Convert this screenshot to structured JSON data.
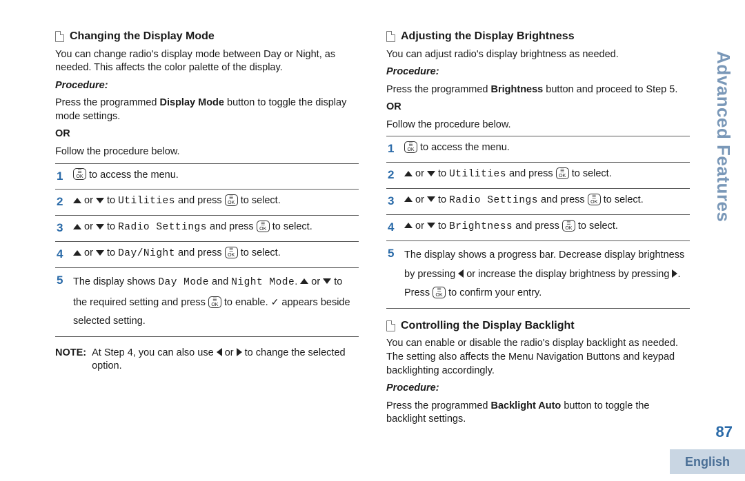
{
  "sideTitle": "Advanced Features",
  "pageNumber": "87",
  "language": "English",
  "left": {
    "heading": "Changing the Display Mode",
    "intro": "You can change radio's display mode between Day or Night, as needed. This affects the color palette of the display.",
    "procLabel": "Procedure:",
    "proc1a": "Press the programmed ",
    "proc1b": "Display Mode",
    "proc1c": " button to toggle the display mode settings.",
    "or": "OR",
    "proc2": "Follow the procedure below.",
    "s1": " to access the menu.",
    "s2or": " or ",
    "s2to": " to ",
    "s2menu": "Utilities",
    "s2press": " and press ",
    "s2sel": " to select.",
    "s3menu": "Radio Settings",
    "s4menu": "Day/Night",
    "s5a": "The display shows ",
    "s5m1": "Day Mode",
    "s5and": " and ",
    "s5m2": "Night Mode",
    "s5dot": ". ",
    "s5to": " to the required setting and press ",
    "s5en": " to enable. ",
    "s5ap": " appears beside selected setting.",
    "noteLabel": "NOTE:",
    "noteA": "At Step 4, you can also use ",
    "noteOr": " or ",
    "noteB": " to change the selected option."
  },
  "rightA": {
    "heading": "Adjusting the Display Brightness",
    "intro": "You can adjust radio's display brightness as needed.",
    "procLabel": "Procedure:",
    "proc1a": "Press the programmed ",
    "proc1b": "Brightness",
    "proc1c": " button and proceed to Step 5.",
    "or": "OR",
    "proc2": "Follow the procedure below.",
    "s1": " to access the menu.",
    "s2menu": "Utilities",
    "s3menu": "Radio Settings",
    "s4menu": "Brightness",
    "s5a": "The display shows a progress bar. Decrease display brightness by pressing ",
    "s5b": " or increase the display brightness by pressing ",
    "s5c": ". Press ",
    "s5d": " to confirm your entry."
  },
  "rightB": {
    "heading": "Controlling the Display Backlight",
    "intro": "You can enable or disable the radio's display backlight as needed. The setting also affects the Menu Navigation Buttons and keypad backlighting accordingly.",
    "procLabel": "Procedure:",
    "proc1a": "Press the programmed ",
    "proc1b": "Backlight Auto",
    "proc1c": " button to toggle the backlight settings."
  },
  "okTop": "☰",
  "okBot": "OK",
  "nums": [
    "1",
    "2",
    "3",
    "4",
    "5"
  ]
}
